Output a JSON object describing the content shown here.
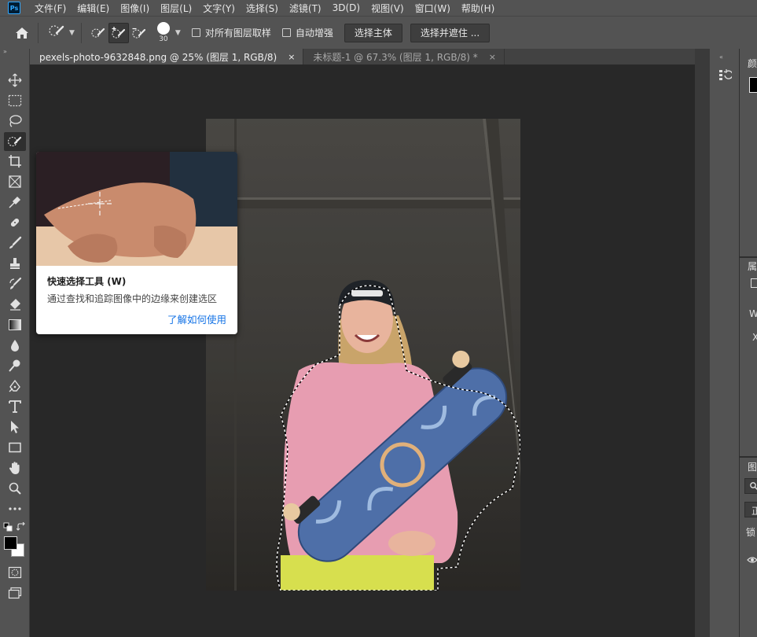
{
  "app": {
    "logo": "Ps"
  },
  "menu": [
    "文件(F)",
    "编辑(E)",
    "图像(I)",
    "图层(L)",
    "文字(Y)",
    "选择(S)",
    "滤镜(T)",
    "3D(D)",
    "视图(V)",
    "窗口(W)",
    "帮助(H)"
  ],
  "options": {
    "brush_size": "30",
    "sample_all_layers": "对所有图层取样",
    "auto_enhance": "自动增强",
    "select_subject": "选择主体",
    "select_and_mask": "选择并遮住 ..."
  },
  "tabs": [
    {
      "label": "pexels-photo-9632848.png @ 25% (图层 1, RGB/8)",
      "close": "×"
    },
    {
      "label": "未标题-1 @ 67.3% (图层 1, RGB/8) *",
      "close": "×"
    }
  ],
  "tooltip": {
    "title": "快速选择工具 (W)",
    "description": "通过查找和追踪图像中的边缘来创建选区",
    "link": "了解如何使用"
  },
  "right_panel": {
    "color_label": "颜",
    "properties_label": "属",
    "w_label": "W",
    "x_label": "X",
    "layers_label": "图",
    "normal_label": "正",
    "lock_label": "锁"
  },
  "colors": {
    "foreground": "#000000",
    "background": "#ffffff",
    "accent": "#1473e6"
  },
  "active_tool": "quick-selection-tool"
}
